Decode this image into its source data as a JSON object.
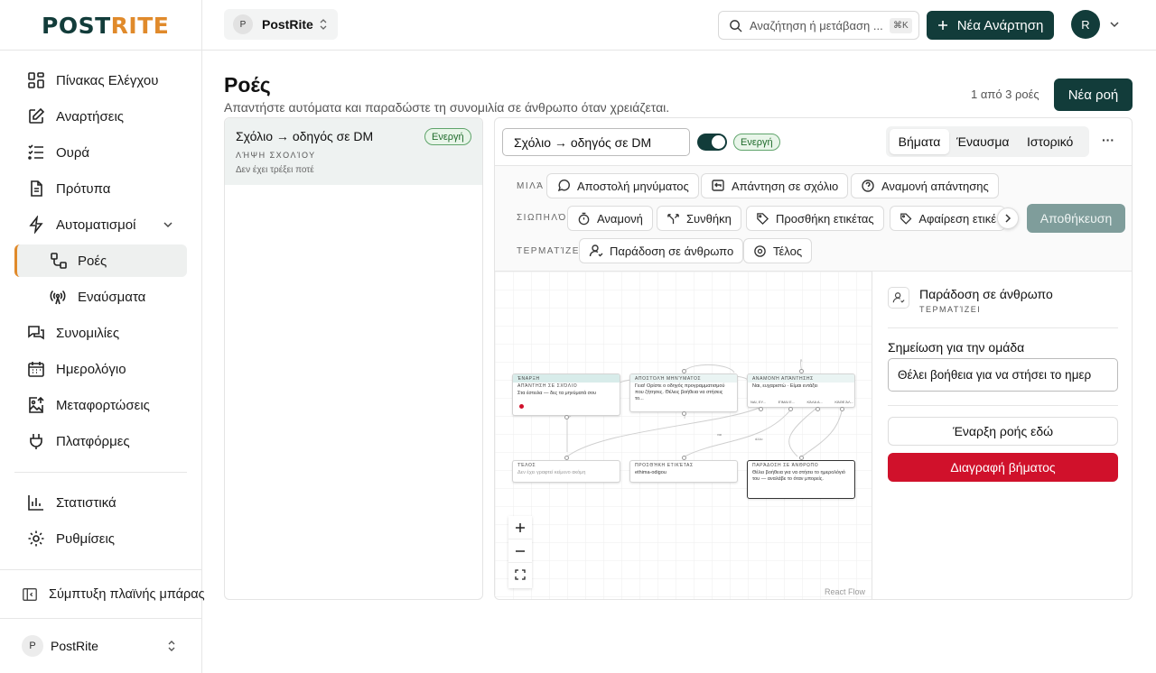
{
  "brand": {
    "logo_text": "POSTRITE",
    "logo_colors": {
      "dark": "#123c3a",
      "accent": "#e08a2b"
    }
  },
  "workspace": {
    "avatar": "P",
    "name": "PostRite"
  },
  "search": {
    "placeholder": "Αναζήτηση ή μετάβαση ...",
    "shortcut": "⌘K"
  },
  "new_post_label": "Νέα Ανάρτηση",
  "user_avatar": "R",
  "nav": {
    "dashboard": "Πίνακας Ελέγχου",
    "posts": "Αναρτήσεις",
    "queue": "Ουρά",
    "templates": "Πρότυπα",
    "automations": "Αυτοματισμοί",
    "flows": "Ροές",
    "triggers": "Εναύσματα",
    "conversations": "Συνομιλίες",
    "calendar": "Ημερολόγιο",
    "uploads": "Μεταφορτώσεις",
    "platforms": "Πλατφόρμες",
    "statistics": "Στατιστικά",
    "settings": "Ρυθμίσεις",
    "collapse": "Σύμπτυξη πλαϊνής μπάρας"
  },
  "footer_workspace": {
    "avatar": "P",
    "name": "PostRite"
  },
  "page": {
    "title": "Ροές",
    "subtitle": "Απαντήστε αυτόματα και παραδώστε τη συνομιλία σε άνθρωπο όταν χρειάζεται.",
    "count": "1 από 3 ροές",
    "new_flow_label": "Νέα ροή"
  },
  "flow_list": [
    {
      "name": "Σχόλιο → οδηγός σε DM",
      "status": "Ενεργή",
      "trigger": "ΛΉΨΗ ΣΧΟΛΊΟΥ",
      "last_run": "Δεν έχει τρέξει ποτέ"
    }
  ],
  "editor": {
    "flow_name": "Σχόλιο → οδηγός σε DM",
    "active_toggle": true,
    "status_badge": "Ενεργή",
    "tabs": [
      "Βήματα",
      "Έναυσμα",
      "Ιστορικό"
    ],
    "active_tab": "Βήματα",
    "more": "···",
    "palette": {
      "speaks_label": "ΜΙΛΆ",
      "speaks": [
        "Αποστολή μηνύματος",
        "Απάντηση σε σχόλιο",
        "Αναμονή απάντησης"
      ],
      "silent_label": "ΣΙΩΠΗΛΌ",
      "silent": [
        "Αναμονή",
        "Συνθήκη",
        "Προσθήκη ετικέτας",
        "Αφαίρεση ετικέ"
      ],
      "ends_label": "ΤΕΡΜΑΤΊΖΕΙ",
      "ends": [
        "Παράδοση σε άνθρωπο",
        "Τέλος"
      ]
    },
    "save_label": "Αποθήκευση",
    "canvas": {
      "nodes": {
        "start_header": "ΈΝΑΡΞΗ",
        "start_sub": "ΑΠΆΝΤΗΣΗ ΣΕ ΣΧΌΛΙΟ",
        "start_text": "Στα έστειλα — δες τα μηνύματά σου",
        "send_header": "ΑΠΟΣΤΟΛΉ ΜΗΝΎΜΑΤΟΣ",
        "send_text": "Γεια! Ορίστε ο οδηγός προγραμματισμού που ζήτησες. Θέλεις βοήθεια να στήσεις το...",
        "wait_header": "ΑΝΑΜΟΝΉ ΑΠΆΝΤΗΣΗΣ",
        "wait_text": "Ναι, ευχαριστώ · Είμαι εντάξει",
        "wait_ports": [
          "ΝΑΙ, ΕΥ...",
          "ΕΊΜΑΙ Ε...",
          "ΚΆΛΑ Α...",
          "ΚΆΘΕ ΆΛ..."
        ],
        "end_header": "ΤΈΛΟΣ",
        "end_text": "Δεν έχει γραφτεί κείμενο ακόμη",
        "tag_header": "ΠΡΟΣΘΉΚΗ ΕΤΙΚΈΤΑΣ",
        "tag_text": "ethima-odigou",
        "handoff_header": "ΠΑΡΆΔΟΣΗ ΣΕ ΆΝΘΡΩΠΟ",
        "handoff_text": "Θέλει βοήθεια για να στήσει το ημερολόγιό του — αναλάβε το όταν μπορείς."
      },
      "edge_label_yes": "ναι",
      "edge_label_other": "άλλο",
      "attribution": "React Flow"
    },
    "inspector": {
      "title": "Παράδοση σε άνθρωπο",
      "subtitle": "ΤΕΡΜΑΤΊΖΕΙ",
      "note_label": "Σημείωση για την ομάδα",
      "note_value": "Θέλει βοήθεια για να στήσει το ημερ",
      "start_here_label": "Έναρξη ροής εδώ",
      "delete_label": "Διαγραφή βήματος"
    }
  },
  "colors": {
    "primary": "#123c3a",
    "accent": "#e08a2b",
    "danger": "#d0112b",
    "active_green": "#5fa46b",
    "save_disabled": "#7f9d9b"
  }
}
